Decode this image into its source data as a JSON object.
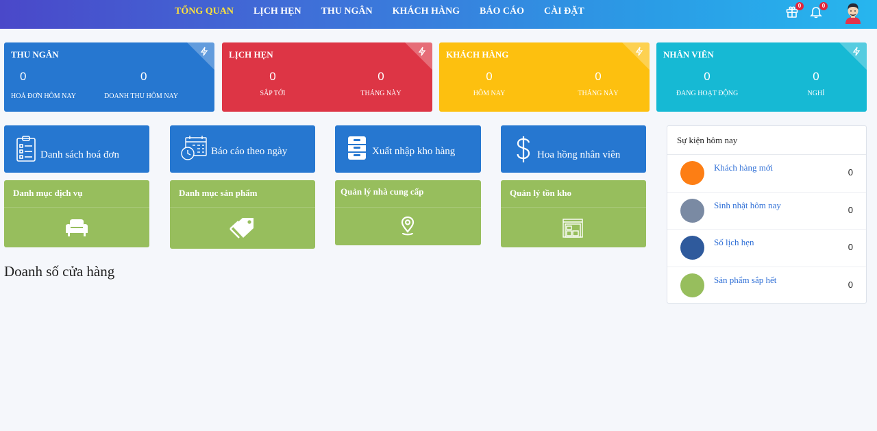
{
  "nav": {
    "items": [
      {
        "label": "TỔNG QUAN",
        "active": true
      },
      {
        "label": "LỊCH HẸN",
        "active": false
      },
      {
        "label": "THU NGÂN",
        "active": false
      },
      {
        "label": "KHÁCH HÀNG",
        "active": false
      },
      {
        "label": "BÁO CÁO",
        "active": false
      },
      {
        "label": "CÀI ĐẶT",
        "active": false
      }
    ],
    "active_color": "#ffe23a",
    "gift_badge": "0",
    "bell_badge": "0"
  },
  "stats": [
    {
      "title": "THU NGÂN",
      "color": "#2677d0",
      "values": [
        {
          "num": "0",
          "label": "HOÁ ĐƠN HÔM NAY"
        },
        {
          "num": "0",
          "label": "DOANH THU HÔM NAY"
        }
      ]
    },
    {
      "title": "LỊCH HẸN",
      "color": "#dd3545",
      "values": [
        {
          "num": "0",
          "label": "SẮP TỚI"
        },
        {
          "num": "0",
          "label": "THÁNG NÀY"
        }
      ]
    },
    {
      "title": "KHÁCH HÀNG",
      "color": "#fdc00f",
      "values": [
        {
          "num": "0",
          "label": "HÔM NAY"
        },
        {
          "num": "0",
          "label": "THÁNG NÀY"
        }
      ]
    },
    {
      "title": "NHÂN VIÊN",
      "color": "#16b9d4",
      "values": [
        {
          "num": "0",
          "label": "ĐANG HOẠT ĐỘNG"
        },
        {
          "num": "0",
          "label": "NGHỈ"
        }
      ]
    }
  ],
  "shortcuts": [
    {
      "label": "Danh sách hoá đơn",
      "icon": "invoice-list-icon"
    },
    {
      "label": "Báo cáo theo ngày",
      "icon": "calendar-clock-icon"
    },
    {
      "label": "Xuất nhập kho hàng",
      "icon": "cabinet-icon"
    },
    {
      "label": "Hoa hồng nhân viên",
      "icon": "dollar-icon"
    }
  ],
  "tiles": [
    {
      "label": "Danh mục dịch vụ",
      "icon": "sofa-icon"
    },
    {
      "label": "Danh mục sản phẩm",
      "icon": "tags-icon"
    },
    {
      "label": "Quản lý nhà cung cấp",
      "icon": "map-pin-icon"
    },
    {
      "label": "Quản lý tồn kho",
      "icon": "warehouse-icon"
    }
  ],
  "section_title": "Doanh số cửa hàng",
  "events": {
    "title": "Sự kiện hôm nay",
    "items": [
      {
        "label": "Khách hàng mới",
        "count": "0",
        "color": "#fd7e14"
      },
      {
        "label": "Sinh nhật hôm nay",
        "count": "0",
        "color": "#7a8aa3"
      },
      {
        "label": "Số lịch hẹn",
        "count": "0",
        "color": "#2f5a9c"
      },
      {
        "label": "Sản phẩm sắp hết",
        "count": "0",
        "color": "#97be5d"
      }
    ]
  }
}
